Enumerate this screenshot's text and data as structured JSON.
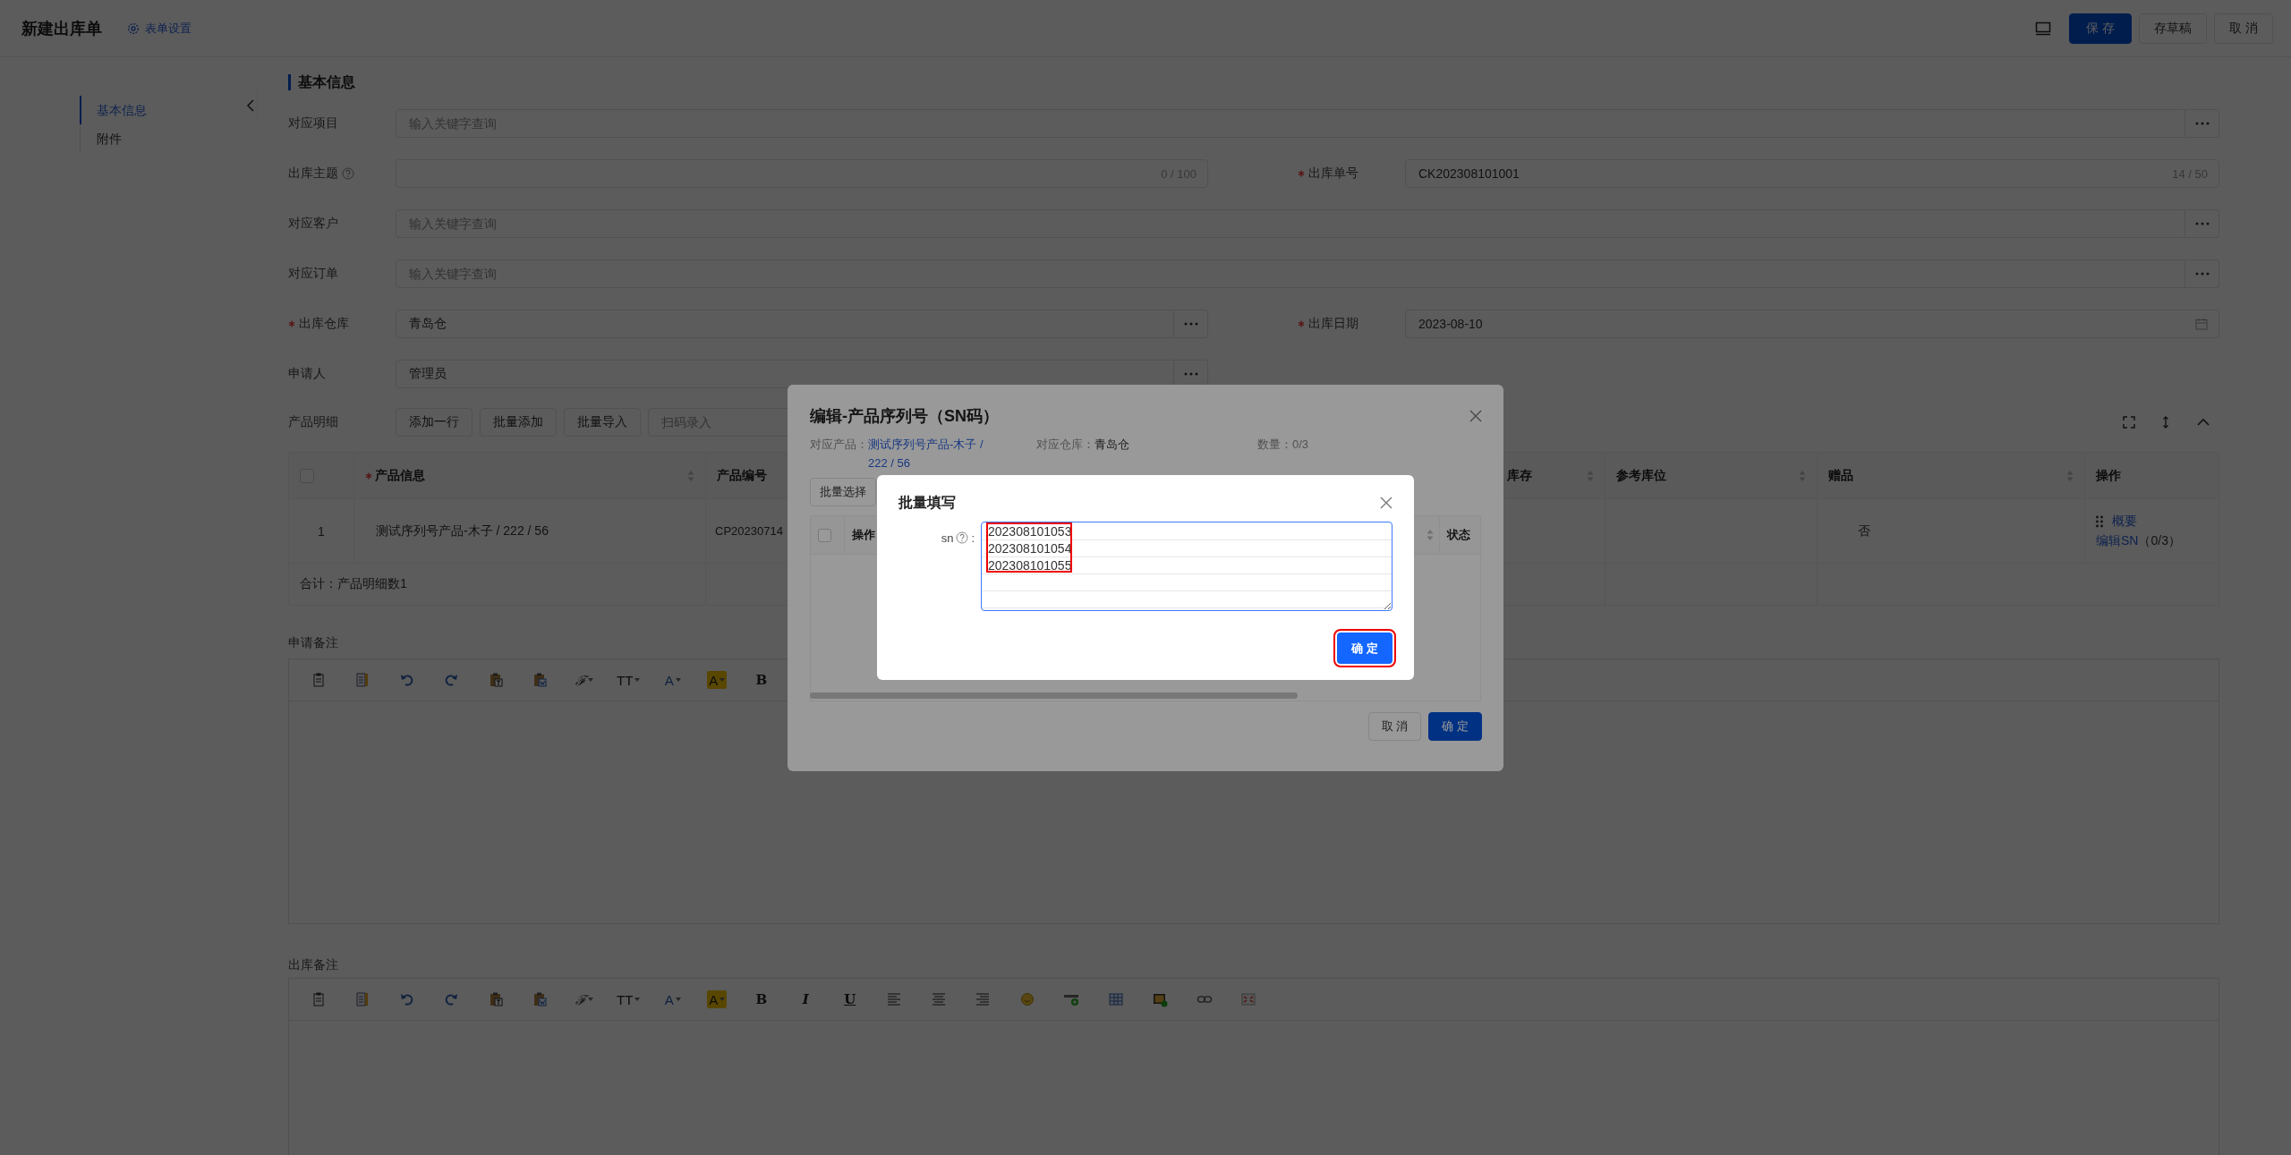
{
  "header": {
    "title": "新建出库单",
    "settings_link": "表单设置",
    "buttons": [
      {
        "label": "保 存",
        "kind": "primary"
      },
      {
        "label": "存草稿",
        "kind": "default"
      },
      {
        "label": "取 消",
        "kind": "default"
      }
    ]
  },
  "nav": [
    {
      "label": "基本信息",
      "selected": true
    },
    {
      "label": "附件",
      "selected": false
    }
  ],
  "section_title": "基本信息",
  "form": {
    "rows": [
      [
        {
          "label": "对应项目",
          "required": false,
          "help": false,
          "kind": "lookup",
          "full_width": true,
          "placeholder": "输入关键字查询"
        }
      ],
      [
        {
          "label": "出库主题",
          "required": false,
          "help": true,
          "kind": "text",
          "full_width": false,
          "count": "0 / 100"
        },
        {
          "label": "出库单号",
          "required": true,
          "help": false,
          "kind": "text",
          "value": "CK202308101001",
          "count": "14 / 50"
        }
      ],
      [
        {
          "label": "对应客户",
          "required": false,
          "help": false,
          "kind": "lookup",
          "full_width": true,
          "placeholder": "输入关键字查询"
        }
      ],
      [
        {
          "label": "对应订单",
          "required": false,
          "help": false,
          "kind": "lookup",
          "full_width": true,
          "placeholder": "输入关键字查询"
        }
      ],
      [
        {
          "label": "出库仓库",
          "required": true,
          "help": false,
          "kind": "lookup",
          "full_width": false,
          "value": "青岛仓"
        },
        {
          "label": "出库日期",
          "required": true,
          "help": false,
          "kind": "date",
          "value": "2023-08-10"
        }
      ],
      [
        {
          "label": "申请人",
          "required": false,
          "help": false,
          "kind": "lookup",
          "full_width": false,
          "value": "管理员"
        }
      ]
    ]
  },
  "products": {
    "label": "产品明细",
    "buttons": [
      "添加一行",
      "批量添加",
      "批量导入"
    ],
    "scan_placeholder": "扫码录入"
  },
  "table": {
    "select_all_checked": false,
    "columns": [
      {
        "label": "产品信息",
        "required": true,
        "sortable": true
      },
      {
        "label": "产品编号",
        "required": false
      },
      {
        "label": "库存",
        "required": false,
        "sortable": true
      },
      {
        "label": "参考库位",
        "required": false,
        "sortable": true
      },
      {
        "label": "赠品",
        "required": false,
        "sortable": true
      },
      {
        "label": "操作",
        "required": false,
        "sortable": false
      }
    ],
    "rows": [
      {
        "index": "1",
        "product": "测试序列号产品-木子 / 222 / 56",
        "code": "CP20230714",
        "gift": "否",
        "actions": [
          {
            "label": "概要"
          },
          {
            "label": "编辑SN",
            "note": "（0/3）"
          }
        ]
      }
    ],
    "footer": "合计：产品明细数1"
  },
  "editors": [
    {
      "label": "申请备注",
      "tools": [
        {
          "kind": "clipboard"
        },
        {
          "kind": "document"
        },
        {
          "kind": "undo"
        },
        {
          "kind": "redo"
        },
        {
          "kind": "paste-text"
        },
        {
          "kind": "paste-word"
        },
        {
          "kind": "font",
          "label": "ℱ"
        },
        {
          "kind": "size",
          "label": "TT"
        },
        {
          "kind": "color",
          "label": "A"
        },
        {
          "kind": "highlight",
          "label": "A"
        },
        {
          "kind": "bold",
          "label": "B"
        }
      ]
    },
    {
      "label": "出库备注",
      "tools": [
        {
          "kind": "clipboard"
        },
        {
          "kind": "document"
        },
        {
          "kind": "undo"
        },
        {
          "kind": "redo"
        },
        {
          "kind": "paste-text"
        },
        {
          "kind": "paste-word"
        },
        {
          "kind": "font",
          "label": "ℱ"
        },
        {
          "kind": "size",
          "label": "TT"
        },
        {
          "kind": "color",
          "label": "A"
        },
        {
          "kind": "highlight",
          "label": "A"
        },
        {
          "kind": "bold",
          "label": "B"
        },
        {
          "kind": "italic",
          "label": "I"
        },
        {
          "kind": "underline",
          "label": "U"
        },
        {
          "kind": "align-left"
        },
        {
          "kind": "align-center"
        },
        {
          "kind": "align-right"
        },
        {
          "kind": "emoji"
        },
        {
          "kind": "horizontal-rule"
        },
        {
          "kind": "table"
        },
        {
          "kind": "image"
        },
        {
          "kind": "link"
        },
        {
          "kind": "fullscreen"
        }
      ]
    }
  ],
  "sn_dialog": {
    "title": "编辑-产品序列号（SN码）",
    "product_label": "对应产品：",
    "product": "测试序列号产品-木子 / 222 / 56",
    "warehouse_label": "对应仓库：",
    "warehouse": "青岛仓",
    "quantity": "数量：0/3",
    "batch_button": "批量选择",
    "select_all_checked": false,
    "columns": [
      {
        "label": "操作",
        "sortable": false
      },
      {
        "sortable": true
      },
      {
        "label": "状态",
        "sortable": false
      }
    ],
    "buttons": [
      {
        "label": "取 消",
        "kind": "default"
      },
      {
        "label": "确 定",
        "kind": "primary"
      }
    ]
  },
  "batch_dialog": {
    "title": "批量填写",
    "field_label": "sn",
    "help": true,
    "field_suffix": ":",
    "value": "202308101053\n202308101054\n202308101055",
    "value_highlighted": true,
    "button": {
      "label": "确 定",
      "highlighted": true
    }
  }
}
